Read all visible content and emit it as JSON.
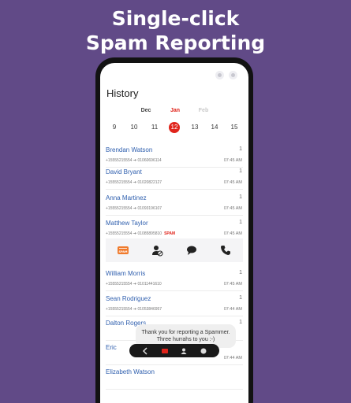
{
  "promo": {
    "line1": "Single-click",
    "line2": "Spam Reporting"
  },
  "screen": {
    "title": "History",
    "months": {
      "prev": "Dec",
      "current": "Jan",
      "next": "Feb"
    },
    "days": [
      "9",
      "10",
      "11",
      "12",
      "13",
      "14",
      "15"
    ],
    "selected_day": "12"
  },
  "calls": [
    {
      "name": "Brendan Watson",
      "count": "1",
      "numbers": "+15555215554 ➔ 01060696114",
      "time": "07:45 AM",
      "spam": ""
    },
    {
      "name": "David Bryant",
      "count": "1",
      "numbers": "+15555215554 ➔ 01020822127",
      "time": "07:45 AM",
      "spam": ""
    },
    {
      "name": "Anna Martinez",
      "count": "1",
      "numbers": "+15555215554 ➔ 01093196107",
      "time": "07:45 AM",
      "spam": ""
    },
    {
      "name": "Matthew Taylor",
      "count": "1",
      "numbers": "+15555215554 ➔ 01085895810",
      "time": "07:45 AM",
      "spam": "SPAM"
    },
    {
      "name": "William Morris",
      "count": "1",
      "numbers": "+15555215554 ➔ 01011441610",
      "time": "07:45 AM",
      "spam": ""
    },
    {
      "name": "Sean Rodriguez",
      "count": "1",
      "numbers": "+15555215554 ➔ 01053846957",
      "time": "07:44 AM",
      "spam": ""
    },
    {
      "name": "Dalton Rogers",
      "count": "1",
      "numbers": "",
      "time": "",
      "spam": ""
    },
    {
      "name": "Eric",
      "count": "",
      "numbers": "",
      "time": "07:44 AM",
      "spam": ""
    },
    {
      "name": "Elizabeth Watson",
      "count": "",
      "numbers": "",
      "time": "",
      "spam": ""
    }
  ],
  "actions": {
    "icons": [
      "report-spam-icon",
      "block-contact-icon",
      "message-icon",
      "phone-icon"
    ],
    "spam_badge_text": "SPAM"
  },
  "toast": {
    "text": "Thank you for reporting a Spammer. Three hurrahs to you :-)"
  },
  "colors": {
    "background": "#614a87",
    "accent_red": "#e0241b",
    "link_blue": "#2f5fae",
    "spam_orange": "#f07a2c"
  }
}
